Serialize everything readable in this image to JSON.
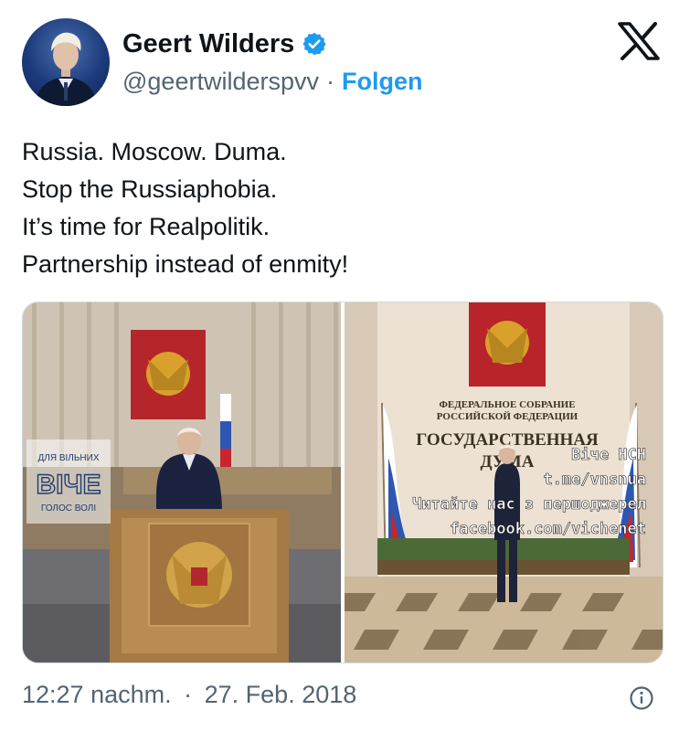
{
  "author": {
    "display_name": "Geert Wilders",
    "handle": "@geertwilderspvv",
    "separator": "·",
    "follow_label": "Folgen",
    "verified_icon": "verified-badge-icon",
    "avatar": "profile-avatar"
  },
  "brand_icon": "x-logo-icon",
  "tweet": {
    "lines": [
      "Russia. Moscow. Duma.",
      "Stop the Russiaphobia.",
      "It’s time for Realpolitik.",
      "Partnership instead of enmity!"
    ]
  },
  "media": {
    "left_watermark": {
      "top": "ДЛЯ ВІЛЬНИХ",
      "logo": "ВІЧЕ",
      "bottom": "ГОЛОС ВОЛІ"
    },
    "right_sign": {
      "line1": "ФЕДЕРАЛЬНОЕ СОБРАНИЕ",
      "line2": "РОССИЙСКОЙ ФЕДЕРАЦИИ",
      "line3": "ГОСУДАРСТВЕННАЯ",
      "line4": "ДУМА"
    },
    "overlay": {
      "line1": "Віче НСН",
      "line2": "t.me/vnsnua",
      "line3": "Читайте нас з першоджерел",
      "line4": "facebook.com/vichenet"
    }
  },
  "footer": {
    "time": "12:27 nachm.",
    "separator": "·",
    "date": "27. Feb. 2018",
    "info_icon": "info-icon"
  },
  "colors": {
    "follow_blue": "#1d9bf0",
    "text": "#0f1419",
    "secondary": "#536471",
    "border": "#cfd9de"
  }
}
